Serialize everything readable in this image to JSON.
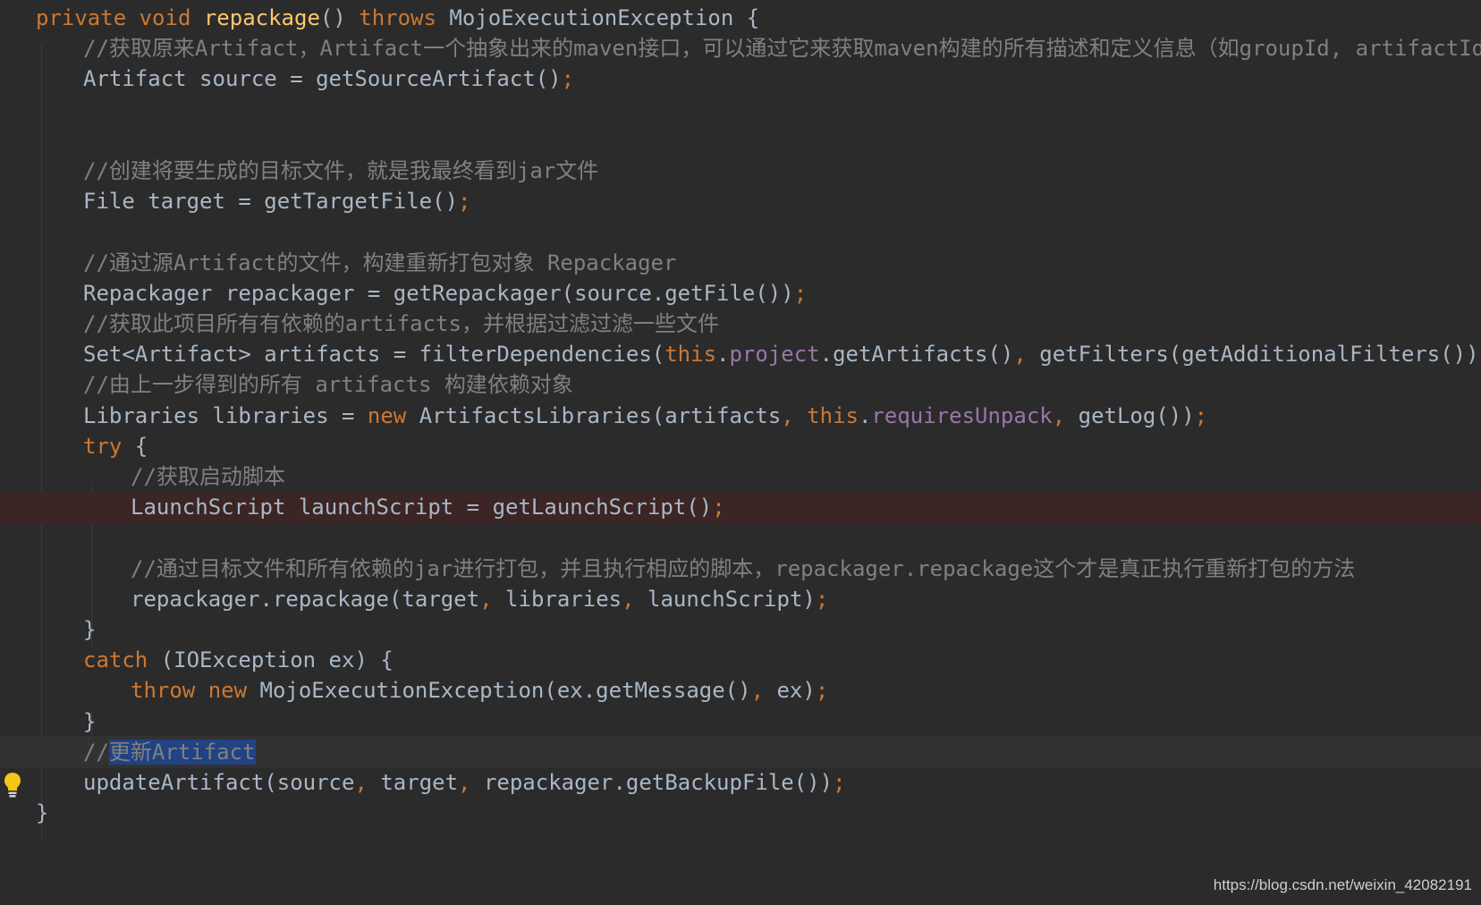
{
  "editor": {
    "language": "java",
    "colors": {
      "background": "#2b2b2b",
      "keyword": "#cc7832",
      "method_declaration": "#ffc66d",
      "comment": "#808080",
      "field": "#9876aa",
      "plain": "#a9b7c6",
      "error_line_bg": "#3c2525",
      "selection_bg": "#214283"
    },
    "lines": [
      {
        "kind": "normal",
        "tokens": [
          {
            "t": "kw",
            "v": "private void "
          },
          {
            "t": "fn",
            "v": "repackage"
          },
          {
            "t": "plain",
            "v": "() "
          },
          {
            "t": "kw",
            "v": "throws "
          },
          {
            "t": "plain",
            "v": "MojoExecutionException {"
          }
        ]
      },
      {
        "kind": "normal",
        "tokens": [
          {
            "t": "cm",
            "v": "//获取原来Artifact，Artifact一个抽象出来的maven接口，可以通过它来获取maven构建的所有描述和定义信息（如groupId, artifactId,"
          }
        ]
      },
      {
        "kind": "normal",
        "tokens": [
          {
            "t": "plain",
            "v": "Artifact source = getSourceArtifact()"
          },
          {
            "t": "kw",
            "v": ";"
          }
        ]
      },
      {
        "kind": "normal",
        "tokens": []
      },
      {
        "kind": "normal",
        "tokens": []
      },
      {
        "kind": "normal",
        "tokens": [
          {
            "t": "cm",
            "v": "//创建将要生成的目标文件，就是我最终看到jar文件"
          }
        ]
      },
      {
        "kind": "normal",
        "tokens": [
          {
            "t": "plain",
            "v": "File target = getTargetFile()"
          },
          {
            "t": "kw",
            "v": ";"
          }
        ]
      },
      {
        "kind": "normal",
        "tokens": []
      },
      {
        "kind": "normal",
        "tokens": [
          {
            "t": "cm",
            "v": "//通过源Artifact的文件，构建重新打包对象 Repackager"
          }
        ]
      },
      {
        "kind": "normal",
        "tokens": [
          {
            "t": "plain",
            "v": "Repackager repackager = getRepackager(source.getFile())"
          },
          {
            "t": "kw",
            "v": ";"
          }
        ]
      },
      {
        "kind": "normal",
        "tokens": [
          {
            "t": "cm",
            "v": "//获取此项目所有有依赖的artifacts，并根据过滤过滤一些文件"
          }
        ]
      },
      {
        "kind": "normal",
        "tokens": [
          {
            "t": "plain",
            "v": "Set<Artifact> artifacts = filterDependencies("
          },
          {
            "t": "kw",
            "v": "this"
          },
          {
            "t": "plain",
            "v": "."
          },
          {
            "t": "field",
            "v": "project"
          },
          {
            "t": "plain",
            "v": ".getArtifacts()"
          },
          {
            "t": "kw",
            "v": ", "
          },
          {
            "t": "plain",
            "v": "getFilters(getAdditionalFilters()))"
          },
          {
            "t": "kw",
            "v": ";"
          }
        ]
      },
      {
        "kind": "normal",
        "tokens": [
          {
            "t": "cm",
            "v": "//由上一步得到的所有 artifacts 构建依赖对象"
          }
        ]
      },
      {
        "kind": "normal",
        "tokens": [
          {
            "t": "plain",
            "v": "Libraries libraries = "
          },
          {
            "t": "kw",
            "v": "new "
          },
          {
            "t": "plain",
            "v": "ArtifactsLibraries(artifacts"
          },
          {
            "t": "kw",
            "v": ", this"
          },
          {
            "t": "plain",
            "v": "."
          },
          {
            "t": "field",
            "v": "requiresUnpack"
          },
          {
            "t": "kw",
            "v": ", "
          },
          {
            "t": "plain",
            "v": "getLog())"
          },
          {
            "t": "kw",
            "v": ";"
          }
        ]
      },
      {
        "kind": "normal",
        "tokens": [
          {
            "t": "kw",
            "v": "try "
          },
          {
            "t": "plain",
            "v": "{"
          }
        ]
      },
      {
        "kind": "normal",
        "tokens": [
          {
            "t": "cm",
            "v": "//获取启动脚本"
          }
        ]
      },
      {
        "kind": "error",
        "tokens": [
          {
            "t": "plain",
            "v": "LaunchScript launchScript = getLaunchScript()"
          },
          {
            "t": "kw",
            "v": ";"
          }
        ]
      },
      {
        "kind": "normal",
        "tokens": []
      },
      {
        "kind": "normal",
        "tokens": [
          {
            "t": "cm",
            "v": "//通过目标文件和所有依赖的jar进行打包，并且执行相应的脚本，repackager.repackage这个才是真正执行重新打包的方法"
          }
        ]
      },
      {
        "kind": "normal",
        "tokens": [
          {
            "t": "plain",
            "v": "repackager.repackage(target"
          },
          {
            "t": "kw",
            "v": ", "
          },
          {
            "t": "plain",
            "v": "libraries"
          },
          {
            "t": "kw",
            "v": ", "
          },
          {
            "t": "plain",
            "v": "launchScript)"
          },
          {
            "t": "kw",
            "v": ";"
          }
        ]
      },
      {
        "kind": "normal",
        "tokens": [
          {
            "t": "plain",
            "v": "}"
          }
        ]
      },
      {
        "kind": "normal",
        "tokens": [
          {
            "t": "kw",
            "v": "catch "
          },
          {
            "t": "plain",
            "v": "(IOException ex) {"
          }
        ]
      },
      {
        "kind": "normal",
        "tokens": [
          {
            "t": "kw",
            "v": "throw new "
          },
          {
            "t": "plain",
            "v": "MojoExecutionException(ex.getMessage()"
          },
          {
            "t": "kw",
            "v": ", "
          },
          {
            "t": "plain",
            "v": "ex)"
          },
          {
            "t": "kw",
            "v": ";"
          }
        ]
      },
      {
        "kind": "normal",
        "tokens": [
          {
            "t": "plain",
            "v": "}"
          }
        ]
      },
      {
        "kind": "caret",
        "tokens": [
          {
            "t": "cm",
            "v": "//"
          },
          {
            "t": "sel",
            "v": "更新Artifact"
          }
        ]
      },
      {
        "kind": "normal",
        "tokens": [
          {
            "t": "plain",
            "v": "updateArtifact(source"
          },
          {
            "t": "kw",
            "v": ", "
          },
          {
            "t": "plain",
            "v": "target"
          },
          {
            "t": "kw",
            "v": ", "
          },
          {
            "t": "plain",
            "v": "repackager.getBackupFile())"
          },
          {
            "t": "kw",
            "v": ";"
          }
        ]
      },
      {
        "kind": "normal",
        "tokens": [
          {
            "t": "plain",
            "v": "}"
          }
        ]
      }
    ]
  },
  "gutter": {
    "intention_icon": "lightbulb-icon"
  },
  "watermark": "https://blog.csdn.net/weixin_42082191"
}
